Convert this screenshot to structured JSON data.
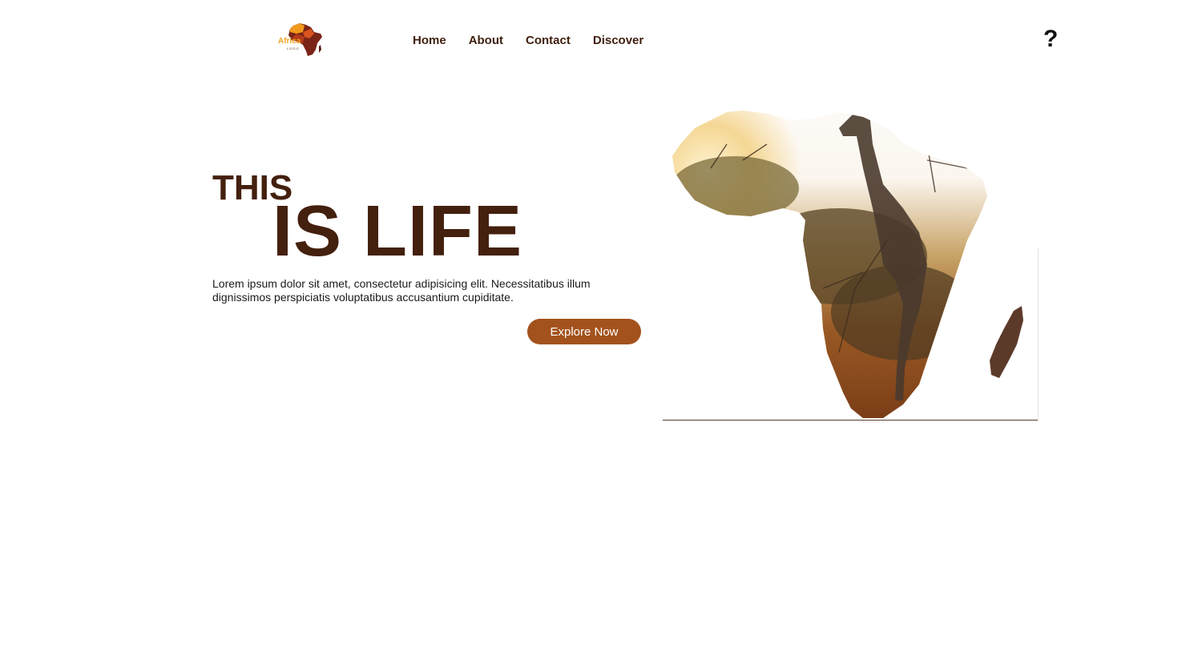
{
  "header": {
    "logo_text": "Africa",
    "logo_subtext": "LOGO",
    "nav": [
      {
        "label": "Home"
      },
      {
        "label": "About"
      },
      {
        "label": "Contact"
      },
      {
        "label": "Discover"
      }
    ],
    "help_icon_glyph": "?"
  },
  "hero": {
    "line1": "THIS",
    "line2": "IS LIFE",
    "description": "Lorem ipsum dolor sit amet, consectetur adipisicing elit. Necessitatibus illum dignissimos perspiciatis voluptatibus accusantium cupiditate.",
    "cta_label": "Explore Now"
  },
  "colors": {
    "heading": "#44200e",
    "nav_text": "#3f1f0e",
    "button_bg": "#a3521d",
    "logo_accent": "#f1a21e"
  },
  "icons": {
    "logo": "africa-map-logo-icon",
    "help": "question-mark-icon",
    "hero_image": "africa-giraffe-map-image"
  }
}
